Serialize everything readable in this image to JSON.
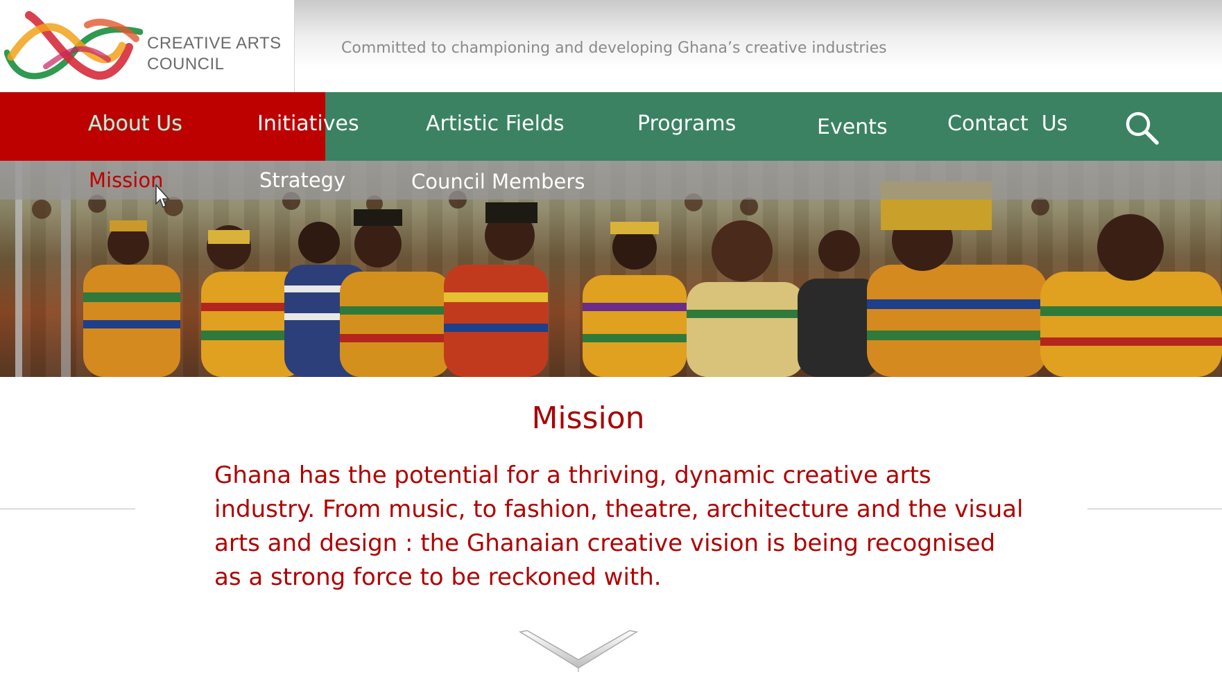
{
  "header": {
    "logo": {
      "line1": "CREATIVE ARTS",
      "line2": "COUNCIL"
    },
    "tagline": "Committed to championing and developing Ghana’s creative industries"
  },
  "nav": {
    "items": [
      {
        "label": "About Us",
        "active": true
      },
      {
        "label": "Initiatives",
        "active": false
      },
      {
        "label": "Artistic Fields",
        "active": false
      },
      {
        "label": "Programs",
        "active": false
      },
      {
        "label": "Events",
        "active": false
      },
      {
        "label": "Contact  Us",
        "active": false
      }
    ],
    "search_icon": "search-icon"
  },
  "subnav": {
    "items": [
      {
        "label": "Mission",
        "active": true
      },
      {
        "label": "Strategy",
        "active": false
      },
      {
        "label": "Council Members",
        "active": false
      }
    ]
  },
  "content": {
    "title": "Mission",
    "body": "Ghana has the potential for a thriving, dynamic creative arts industry. From music, to fashion, theatre, architecture and the visual arts and design : the Ghanaian creative vision is being recognised as a strong force to be reckoned with."
  },
  "colors": {
    "brand_red": "#bd0000",
    "brand_green": "#3a8262",
    "text_red": "#b10000",
    "subnav_gray": "#969696"
  },
  "icons": {
    "scroll": "chevron-down-icon"
  }
}
